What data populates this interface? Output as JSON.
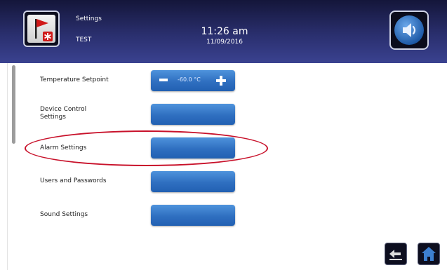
{
  "header": {
    "title": "Settings",
    "subtitle": "TEST",
    "time": "11:26 am",
    "date": "11/09/2016"
  },
  "settings": {
    "temperature": {
      "label": "Temperature Setpoint",
      "value": "-60.0 °C"
    },
    "device_control": {
      "label_line1": "Device Control",
      "label_line2": "Settings"
    },
    "alarm": {
      "label": "Alarm Settings"
    },
    "users": {
      "label": "Users and Passwords"
    },
    "sound": {
      "label": "Sound Settings"
    }
  },
  "icons": {
    "status": "flag-alarm-icon",
    "sound": "speaker-icon",
    "back": "back-arrow-icon",
    "home": "home-icon"
  },
  "colors": {
    "header": "#2a2f6e",
    "button": "#2f6fc0",
    "highlight": "#c8112a"
  }
}
